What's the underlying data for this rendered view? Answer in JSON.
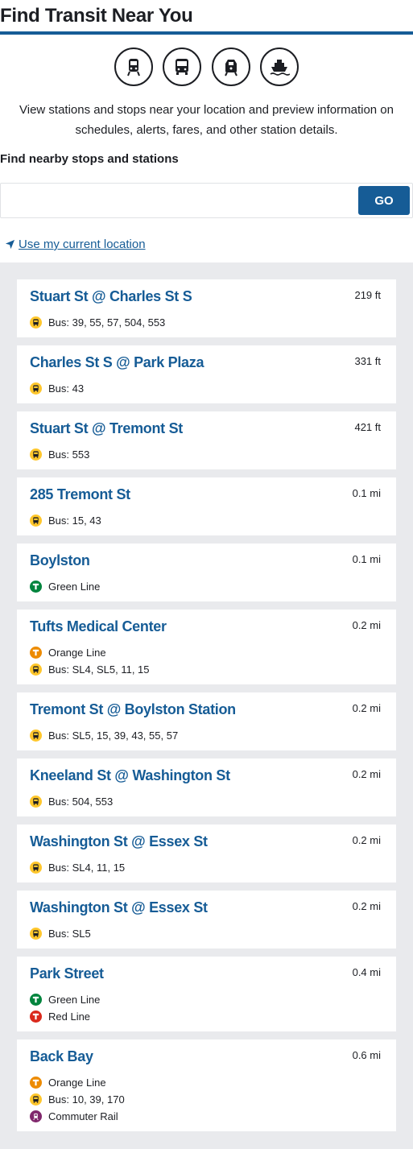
{
  "header": {
    "title": "Find Transit Near You"
  },
  "modes": [
    {
      "icon": "subway-icon"
    },
    {
      "icon": "bus-icon"
    },
    {
      "icon": "commuter-rail-icon"
    },
    {
      "icon": "ferry-icon"
    }
  ],
  "intro": {
    "line1": "View stations and stops near your location and preview information on",
    "line2": "schedules, alerts, fares, and other station details."
  },
  "search": {
    "label": "Find nearby stops and stations",
    "value": "",
    "placeholder": "",
    "button_label": "GO"
  },
  "location_link": "Use my current location",
  "colors": {
    "accent": "#165c96",
    "bus": "#ffc72c",
    "green_line": "#00843d",
    "orange_line": "#ed8b00",
    "red_line": "#da291c",
    "commuter_rail": "#80276c",
    "results_bg": "#e9eaed"
  },
  "stops": [
    {
      "name": "Stuart St @ Charles St S",
      "distance": "219 ft",
      "routes": [
        {
          "type": "bus",
          "icon": "bus-icon",
          "label": "Bus: 39, 55, 57, 504, 553"
        }
      ]
    },
    {
      "name": "Charles St S @ Park Plaza",
      "distance": "331 ft",
      "routes": [
        {
          "type": "bus",
          "icon": "bus-icon",
          "label": "Bus: 43"
        }
      ]
    },
    {
      "name": "Stuart St @ Tremont St",
      "distance": "421 ft",
      "routes": [
        {
          "type": "bus",
          "icon": "bus-icon",
          "label": "Bus: 553"
        }
      ]
    },
    {
      "name": "285 Tremont St",
      "distance": "0.1 mi",
      "routes": [
        {
          "type": "bus",
          "icon": "bus-icon",
          "label": "Bus: 15, 43"
        }
      ]
    },
    {
      "name": "Boylston",
      "distance": "0.1 mi",
      "routes": [
        {
          "type": "green",
          "icon": "t-logo-icon",
          "label": "Green Line"
        }
      ]
    },
    {
      "name": "Tufts Medical Center",
      "distance": "0.2 mi",
      "routes": [
        {
          "type": "orange",
          "icon": "t-logo-icon",
          "label": "Orange Line"
        },
        {
          "type": "bus",
          "icon": "bus-icon",
          "label": "Bus: SL4, SL5, 11, 15"
        }
      ]
    },
    {
      "name": "Tremont St @ Boylston Station",
      "distance": "0.2 mi",
      "routes": [
        {
          "type": "bus",
          "icon": "bus-icon",
          "label": "Bus: SL5, 15, 39, 43, 55, 57"
        }
      ]
    },
    {
      "name": "Kneeland St @ Washington St",
      "distance": "0.2 mi",
      "routes": [
        {
          "type": "bus",
          "icon": "bus-icon",
          "label": "Bus: 504, 553"
        }
      ]
    },
    {
      "name": "Washington St @ Essex St",
      "distance": "0.2 mi",
      "routes": [
        {
          "type": "bus",
          "icon": "bus-icon",
          "label": "Bus: SL4, 11, 15"
        }
      ]
    },
    {
      "name": "Washington St @ Essex St",
      "distance": "0.2 mi",
      "routes": [
        {
          "type": "bus",
          "icon": "bus-icon",
          "label": "Bus: SL5"
        }
      ]
    },
    {
      "name": "Park Street",
      "distance": "0.4 mi",
      "routes": [
        {
          "type": "green",
          "icon": "t-logo-icon",
          "label": "Green Line"
        },
        {
          "type": "red",
          "icon": "t-logo-icon",
          "label": "Red Line"
        }
      ]
    },
    {
      "name": "Back Bay",
      "distance": "0.6 mi",
      "routes": [
        {
          "type": "orange",
          "icon": "t-logo-icon",
          "label": "Orange Line"
        },
        {
          "type": "bus",
          "icon": "bus-icon",
          "label": "Bus: 10, 39, 170"
        },
        {
          "type": "commuter",
          "icon": "commuter-rail-icon",
          "label": "Commuter Rail"
        }
      ]
    }
  ]
}
